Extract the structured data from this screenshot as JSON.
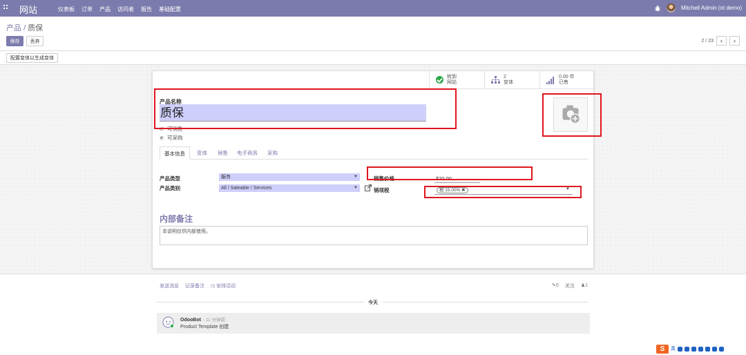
{
  "navbar": {
    "brand": "网站",
    "menu": [
      "仪表板",
      "订单",
      "产品",
      "访问者",
      "报告",
      "基础配置"
    ],
    "user": "Mitchell Admin (ot demo)"
  },
  "control": {
    "breadcrumb_parent": "产品",
    "breadcrumb_sep": " / ",
    "breadcrumb_current": "质保",
    "save_label": "保存",
    "discard_label": "丢弃",
    "pager": "2 / 23",
    "variant_button": "配置变体以生成变体"
  },
  "smart_buttons": {
    "website_line1": "转到",
    "website_line2": "网站",
    "variants_line1": "2",
    "variants_line2": "变体",
    "sold_line1": "0.00 件",
    "sold_line2": "已售"
  },
  "form": {
    "name_label": "产品名称",
    "name_value": "质保",
    "can_sell": "可销售",
    "can_purchase": "可采购",
    "tabs": [
      "基本信息",
      "变体",
      "销售",
      "电子商务",
      "采购"
    ],
    "type_label": "产品类型",
    "type_value": "服务",
    "category_label": "产品类别",
    "category_value": "All / Saleable / Services",
    "price_label": "销售价格",
    "price_value": "$20.00",
    "tax_label": "销项税",
    "tax_tag": "税 15.00%",
    "notes_title": "内部备注",
    "notes_placeholder": "本说明仅供内部使用。"
  },
  "chatter": {
    "send_message": "发送消息",
    "log_note": "记录备注",
    "schedule_activity": "安排活动",
    "attachments": "0",
    "follow": "关注",
    "followers": "1",
    "today": "今天",
    "author": "OdooBot",
    "time": "- 11 分钟前",
    "body": "Product Template 创建"
  },
  "ime": {
    "logo": "S",
    "lang": "英"
  },
  "colors": {
    "primary": "#7c7bad",
    "input_bg": "#cfcffc",
    "highlight_red": "#e0141e",
    "published_green": "#28a745"
  }
}
